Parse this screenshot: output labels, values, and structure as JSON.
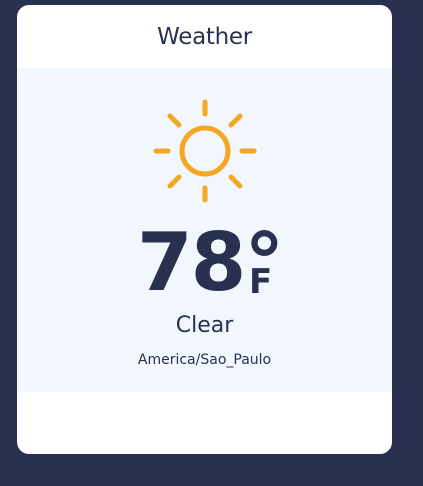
{
  "widget": {
    "title": "Weather",
    "icon": "sun-icon",
    "temperature": "78°",
    "unit": "F",
    "condition": "Clear",
    "timezone": "America/Sao_Paulo"
  },
  "colors": {
    "background": "#2a3150",
    "card": "#ffffff",
    "body_bg": "#f1f7fd",
    "text": "#2a3150",
    "sun": "#f5a623"
  }
}
